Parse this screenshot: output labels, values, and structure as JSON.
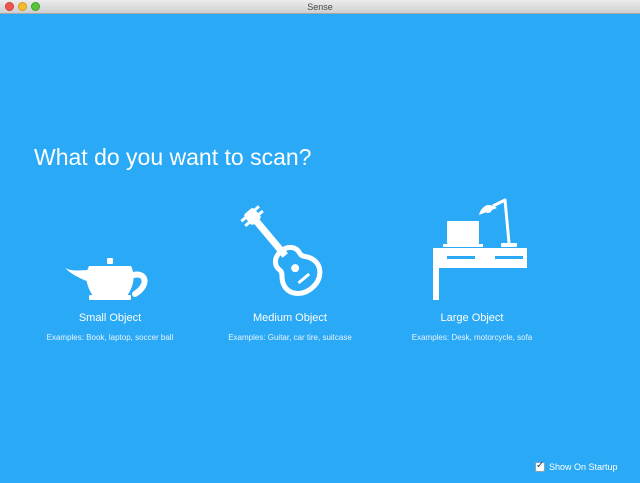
{
  "window": {
    "title": "Sense"
  },
  "heading": "What do you want to scan?",
  "options": [
    {
      "id": "small",
      "icon": "teapot-icon",
      "title": "Small Object",
      "examples": "Examples: Book, laptop, soccer ball"
    },
    {
      "id": "medium",
      "icon": "guitar-icon",
      "title": "Medium Object",
      "examples": "Examples: Guitar, car tire, suitcase"
    },
    {
      "id": "large",
      "icon": "desk-icon",
      "title": "Large Object",
      "examples": "Examples: Desk, motorcycle, sofa"
    }
  ],
  "footer": {
    "show_on_startup_label": "Show On Startup",
    "show_on_startup_checked": true
  },
  "colors": {
    "background": "#2aa9f7",
    "foreground": "#ffffff"
  }
}
